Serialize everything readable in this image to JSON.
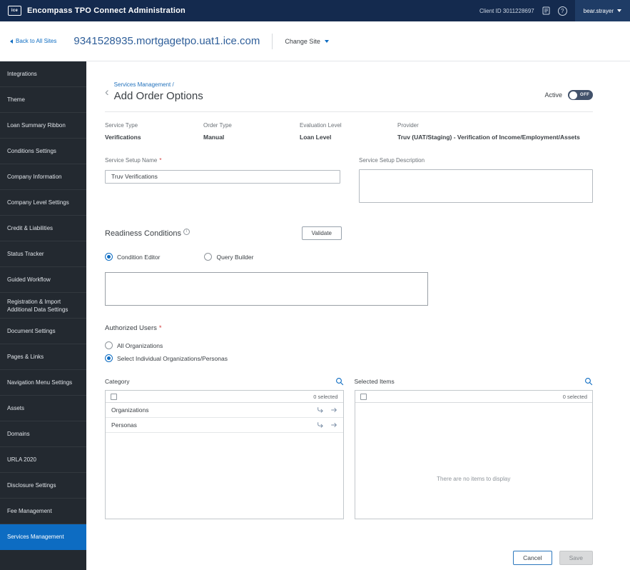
{
  "colors": {
    "topbar": "#142a4e",
    "sidebar": "#232930",
    "accent": "#0d6cc2",
    "active_item": "#0d6cc2",
    "required": "#d13a3a"
  },
  "topbar": {
    "logo_text": "ice",
    "title": "Encompass TPO Connect Administration",
    "client_id": "Client ID 3011228697",
    "username": "bear.strayer"
  },
  "sitebar": {
    "back_link": "Back to All Sites",
    "site_url": "9341528935.mortgagetpo.uat1.ice.com",
    "change_site": "Change Site"
  },
  "sidebar": {
    "items": [
      {
        "label": "Integrations"
      },
      {
        "label": "Theme"
      },
      {
        "label": "Loan Summary Ribbon"
      },
      {
        "label": "Conditions Settings"
      },
      {
        "label": "Company Information"
      },
      {
        "label": "Company Level Settings"
      },
      {
        "label": "Credit & Liabilities"
      },
      {
        "label": "Status Tracker"
      },
      {
        "label": "Guided Workflow"
      },
      {
        "label": "Registration & Import Additional Data Settings"
      },
      {
        "label": "Document Settings"
      },
      {
        "label": "Pages & Links"
      },
      {
        "label": "Navigation Menu Settings"
      },
      {
        "label": "Assets"
      },
      {
        "label": "Domains"
      },
      {
        "label": "URLA 2020"
      },
      {
        "label": "Disclosure Settings"
      },
      {
        "label": "Fee Management"
      },
      {
        "label": "Services Management",
        "active": true
      }
    ]
  },
  "main": {
    "breadcrumb": "Services Management /",
    "title": "Add Order Options",
    "active_label": "Active",
    "toggle": "OFF",
    "summary": [
      {
        "label": "Service Type",
        "value": "Verifications"
      },
      {
        "label": "Order Type",
        "value": "Manual"
      },
      {
        "label": "Evaluation Level",
        "value": "Loan Level"
      },
      {
        "label": "Provider",
        "value": "Truv (UAT/Staging) - Verification of Income/Employment/Assets"
      }
    ],
    "name_field": {
      "label": "Service Setup Name",
      "required": "*",
      "value": "Truv Verifications"
    },
    "description_field": {
      "label": "Service Setup Description",
      "value": ""
    },
    "readiness": {
      "heading": "Readiness Conditions",
      "validate": "Validate",
      "options": [
        {
          "label": "Condition Editor",
          "selected": true
        },
        {
          "label": "Query Builder",
          "selected": false
        }
      ],
      "editor_value": ""
    },
    "authorized": {
      "heading": "Authorized Users",
      "required": "*",
      "options": [
        {
          "label": "All Organizations",
          "selected": false
        },
        {
          "label": "Select Individual Organizations/Personas",
          "selected": true
        }
      ]
    },
    "category_panel": {
      "title": "Category",
      "selected_count": "0 selected",
      "rows": [
        {
          "label": "Organizations"
        },
        {
          "label": "Personas"
        }
      ]
    },
    "selected_panel": {
      "title": "Selected Items",
      "selected_count": "0 selected",
      "empty_message": "There are no items to display"
    },
    "actions": {
      "cancel": "Cancel",
      "save": "Save"
    }
  }
}
